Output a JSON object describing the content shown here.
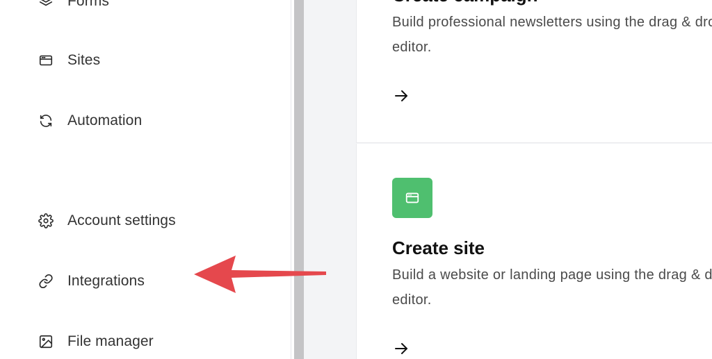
{
  "sidebar": {
    "items": [
      {
        "label": "Forms",
        "icon": "layers-icon"
      },
      {
        "label": "Sites",
        "icon": "browser-window-icon"
      },
      {
        "label": "Automation",
        "icon": "refresh-icon"
      },
      {
        "label": "Account settings",
        "icon": "gear-icon"
      },
      {
        "label": "Integrations",
        "icon": "link-icon"
      },
      {
        "label": "File manager",
        "icon": "image-icon"
      }
    ]
  },
  "main": {
    "cards": [
      {
        "title": "Create campaign",
        "description": "Build professional newsletters using the drag & drop editor.",
        "action_icon": "arrow-right-icon"
      },
      {
        "title": "Create site",
        "description": "Build a website or landing page using the drag & drop editor.",
        "tile_icon": "browser-window-icon",
        "action_icon": "arrow-right-icon"
      }
    ]
  },
  "annotation": {
    "icon": "red-pointer-arrow-icon",
    "color": "#e5484d"
  },
  "colors": {
    "tile_green": "#4fbf6f",
    "divider": "#c4c4c6",
    "main_bg": "#f3f4f6"
  }
}
